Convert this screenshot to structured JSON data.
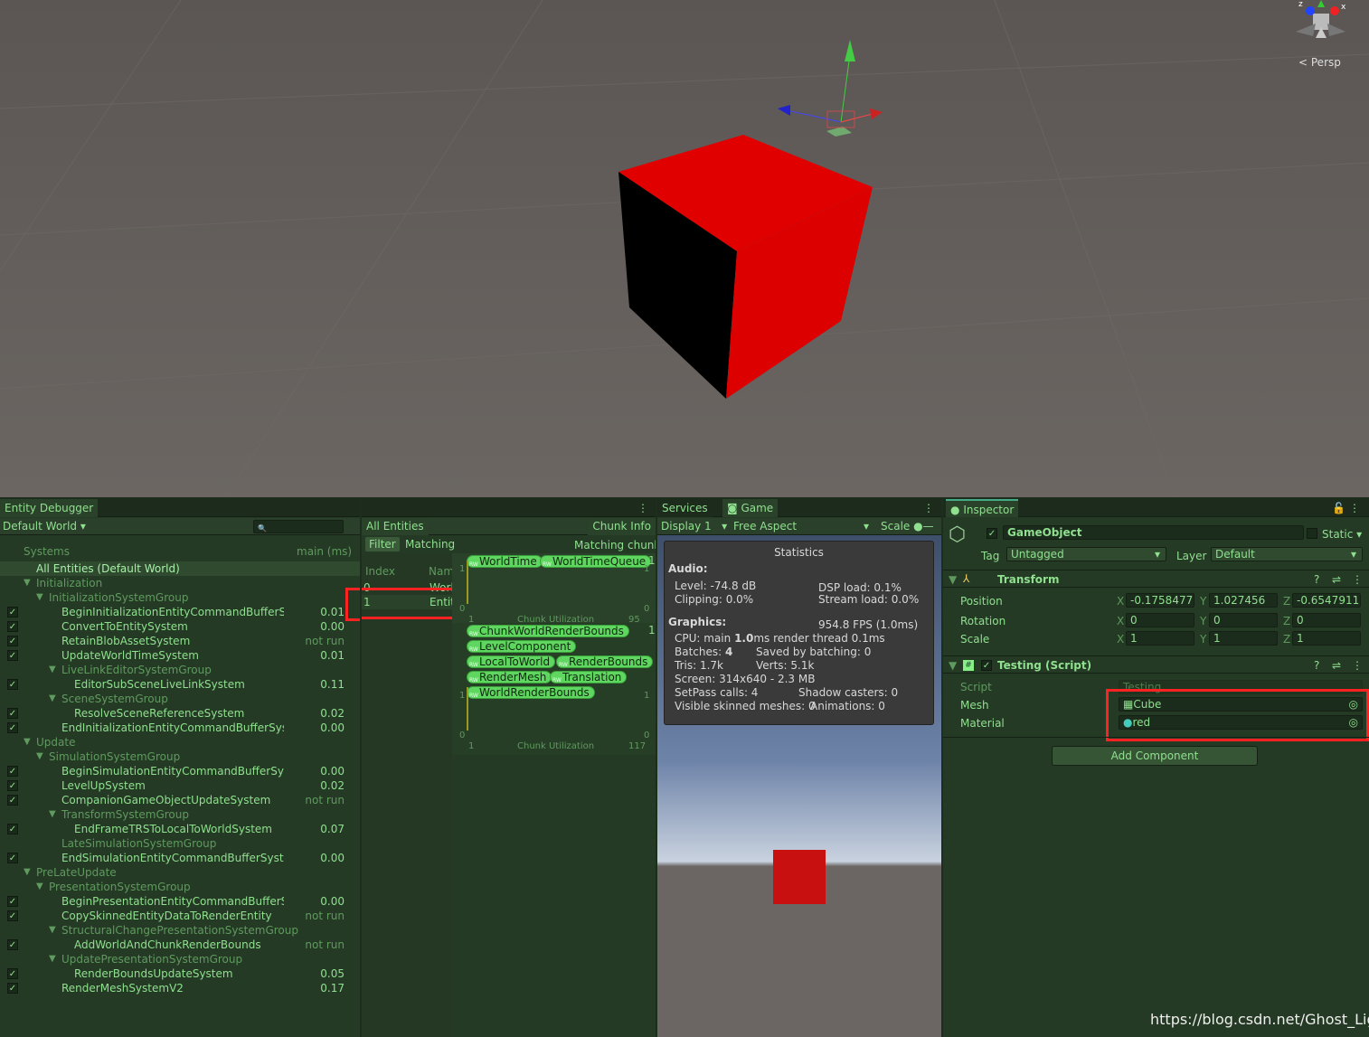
{
  "scene": {
    "view_mode": "Persp",
    "axes": [
      "x",
      "y",
      "z"
    ],
    "colors": {
      "cube": "#e00000",
      "cube_dark": "#000000"
    }
  },
  "entity_debugger": {
    "tab": "Entity Debugger",
    "world_select": "Default World",
    "search_placeholder": "",
    "col_systems": "Systems",
    "col_main": "main (ms)",
    "all_entities": "All Entities (Default World)",
    "rows": [
      {
        "name": "Initialization",
        "level": 0,
        "group": true
      },
      {
        "name": "InitializationSystemGroup",
        "level": 1,
        "group": true
      },
      {
        "name": "BeginInitializationEntityCommandBufferSyst",
        "level": 2,
        "value": "0.01",
        "checked": true
      },
      {
        "name": "ConvertToEntitySystem",
        "level": 2,
        "value": "0.00",
        "checked": true
      },
      {
        "name": "RetainBlobAssetSystem",
        "level": 2,
        "value": "not run",
        "checked": true
      },
      {
        "name": "UpdateWorldTimeSystem",
        "level": 2,
        "value": "0.01",
        "checked": true
      },
      {
        "name": "LiveLinkEditorSystemGroup",
        "level": 2,
        "group": true
      },
      {
        "name": "EditorSubSceneLiveLinkSystem",
        "level": 3,
        "value": "0.11",
        "checked": true
      },
      {
        "name": "SceneSystemGroup",
        "level": 2,
        "group": true
      },
      {
        "name": "ResolveSceneReferenceSystem",
        "level": 3,
        "value": "0.02",
        "checked": true
      },
      {
        "name": "EndInitializationEntityCommandBufferSystem",
        "level": 2,
        "value": "0.00",
        "checked": true
      },
      {
        "name": "Update",
        "level": 0,
        "group": true
      },
      {
        "name": "SimulationSystemGroup",
        "level": 1,
        "group": true
      },
      {
        "name": "BeginSimulationEntityCommandBufferSyste",
        "level": 2,
        "value": "0.00",
        "checked": true
      },
      {
        "name": "LevelUpSystem",
        "level": 2,
        "value": "0.02",
        "checked": true
      },
      {
        "name": "CompanionGameObjectUpdateSystem",
        "level": 2,
        "value": "not run",
        "checked": true
      },
      {
        "name": "TransformSystemGroup",
        "level": 2,
        "group": true
      },
      {
        "name": "EndFrameTRSToLocalToWorldSystem",
        "level": 3,
        "value": "0.07",
        "checked": true
      },
      {
        "name": "LateSimulationSystemGroup",
        "level": 2,
        "group": true,
        "noarrow": true
      },
      {
        "name": "EndSimulationEntityCommandBufferSystem",
        "level": 2,
        "value": "0.00",
        "checked": true
      },
      {
        "name": "PreLateUpdate",
        "level": 0,
        "group": true
      },
      {
        "name": "PresentationSystemGroup",
        "level": 1,
        "group": true
      },
      {
        "name": "BeginPresentationEntityCommandBufferSys",
        "level": 2,
        "value": "0.00",
        "checked": true
      },
      {
        "name": "CopySkinnedEntityDataToRenderEntity",
        "level": 2,
        "value": "not run",
        "checked": true
      },
      {
        "name": "StructuralChangePresentationSystemGroup",
        "level": 2,
        "group": true
      },
      {
        "name": "AddWorldAndChunkRenderBounds",
        "level": 3,
        "value": "not run",
        "checked": true
      },
      {
        "name": "UpdatePresentationSystemGroup",
        "level": 2,
        "group": true
      },
      {
        "name": "RenderBoundsUpdateSystem",
        "level": 3,
        "value": "0.05",
        "checked": true
      },
      {
        "name": "RenderMeshSystemV2",
        "level": 2,
        "value": "0.17",
        "checked": true
      }
    ]
  },
  "entities": {
    "title": "All Entities",
    "chunk_info": "Chunk Info",
    "filter": "Filter",
    "matching": "Matching",
    "matching_chunks": "Matching chunk",
    "col_index": "Index",
    "col_name": "Nam",
    "rows": [
      {
        "index": "0",
        "name": "Worl"
      },
      {
        "index": "1",
        "name": "Entit"
      }
    ],
    "archetypes": [
      {
        "components": [
          "WorldTime",
          "WorldTimeQueue"
        ],
        "count": "1",
        "y_top": "1",
        "y_bottom": "0",
        "x_left": "1",
        "label": "Chunk Utilization",
        "capacity": "95",
        "right_top": "1",
        "right_bottom": "0"
      },
      {
        "components": [
          "ChunkWorldRenderBounds",
          "LevelComponent",
          "LocalToWorld",
          "RenderBounds",
          "RenderMesh",
          "Translation",
          "WorldRenderBounds"
        ],
        "count": "1",
        "y_top": "1",
        "y_bottom": "0",
        "x_left": "1",
        "label": "Chunk Utilization",
        "capacity": "117",
        "right_top": "1",
        "right_bottom": "0"
      }
    ]
  },
  "game": {
    "tabs": [
      "Services",
      "Game"
    ],
    "display": "Display 1",
    "aspect": "Free Aspect",
    "scale": "Scale",
    "stats": {
      "title": "Statistics",
      "audio": "Audio:",
      "level": "Level: -74.8 dB",
      "clipping": "Clipping: 0.0%",
      "dsp": "DSP load: 0.1%",
      "stream": "Stream load: 0.0%",
      "graphics": "Graphics:",
      "fps": "954.8 FPS (1.0ms)",
      "cpu_a": "CPU: main ",
      "cpu_b": "1.0",
      "cpu_c": "ms  render thread 0.1ms",
      "batches_a": "Batches: ",
      "batches_b": "4",
      "saved": "Saved by batching: 0",
      "tris": "Tris: 1.7k",
      "verts": "Verts: 5.1k",
      "screen": "Screen: 314x640 - 2.3 MB",
      "setpass": "SetPass calls: 4",
      "shadow": "Shadow casters: 0",
      "skinned": "Visible skinned meshes: 0",
      "anim": "Animations: 0"
    }
  },
  "inspector": {
    "tab": "Inspector",
    "name": "GameObject",
    "static": "Static",
    "tag_label": "Tag",
    "tag": "Untagged",
    "layer_label": "Layer",
    "layer": "Default",
    "transform": "Transform",
    "position": {
      "label": "Position",
      "x": "-0.1758477",
      "y": "1.027456",
      "z": "-0.6547911"
    },
    "rotation": {
      "label": "Rotation",
      "x": "0",
      "y": "0",
      "z": "0"
    },
    "scale": {
      "label": "Scale",
      "x": "1",
      "y": "1",
      "z": "1"
    },
    "axis": {
      "x": "X",
      "y": "Y",
      "z": "Z"
    },
    "script_comp": "Testing (Script)",
    "script_label": "Script",
    "script": "Testing",
    "mesh_label": "Mesh",
    "mesh": "Cube",
    "material_label": "Material",
    "material": "red",
    "add_component": "Add Component"
  },
  "watermark": "https://blog.csdn.net/Ghost_Light"
}
